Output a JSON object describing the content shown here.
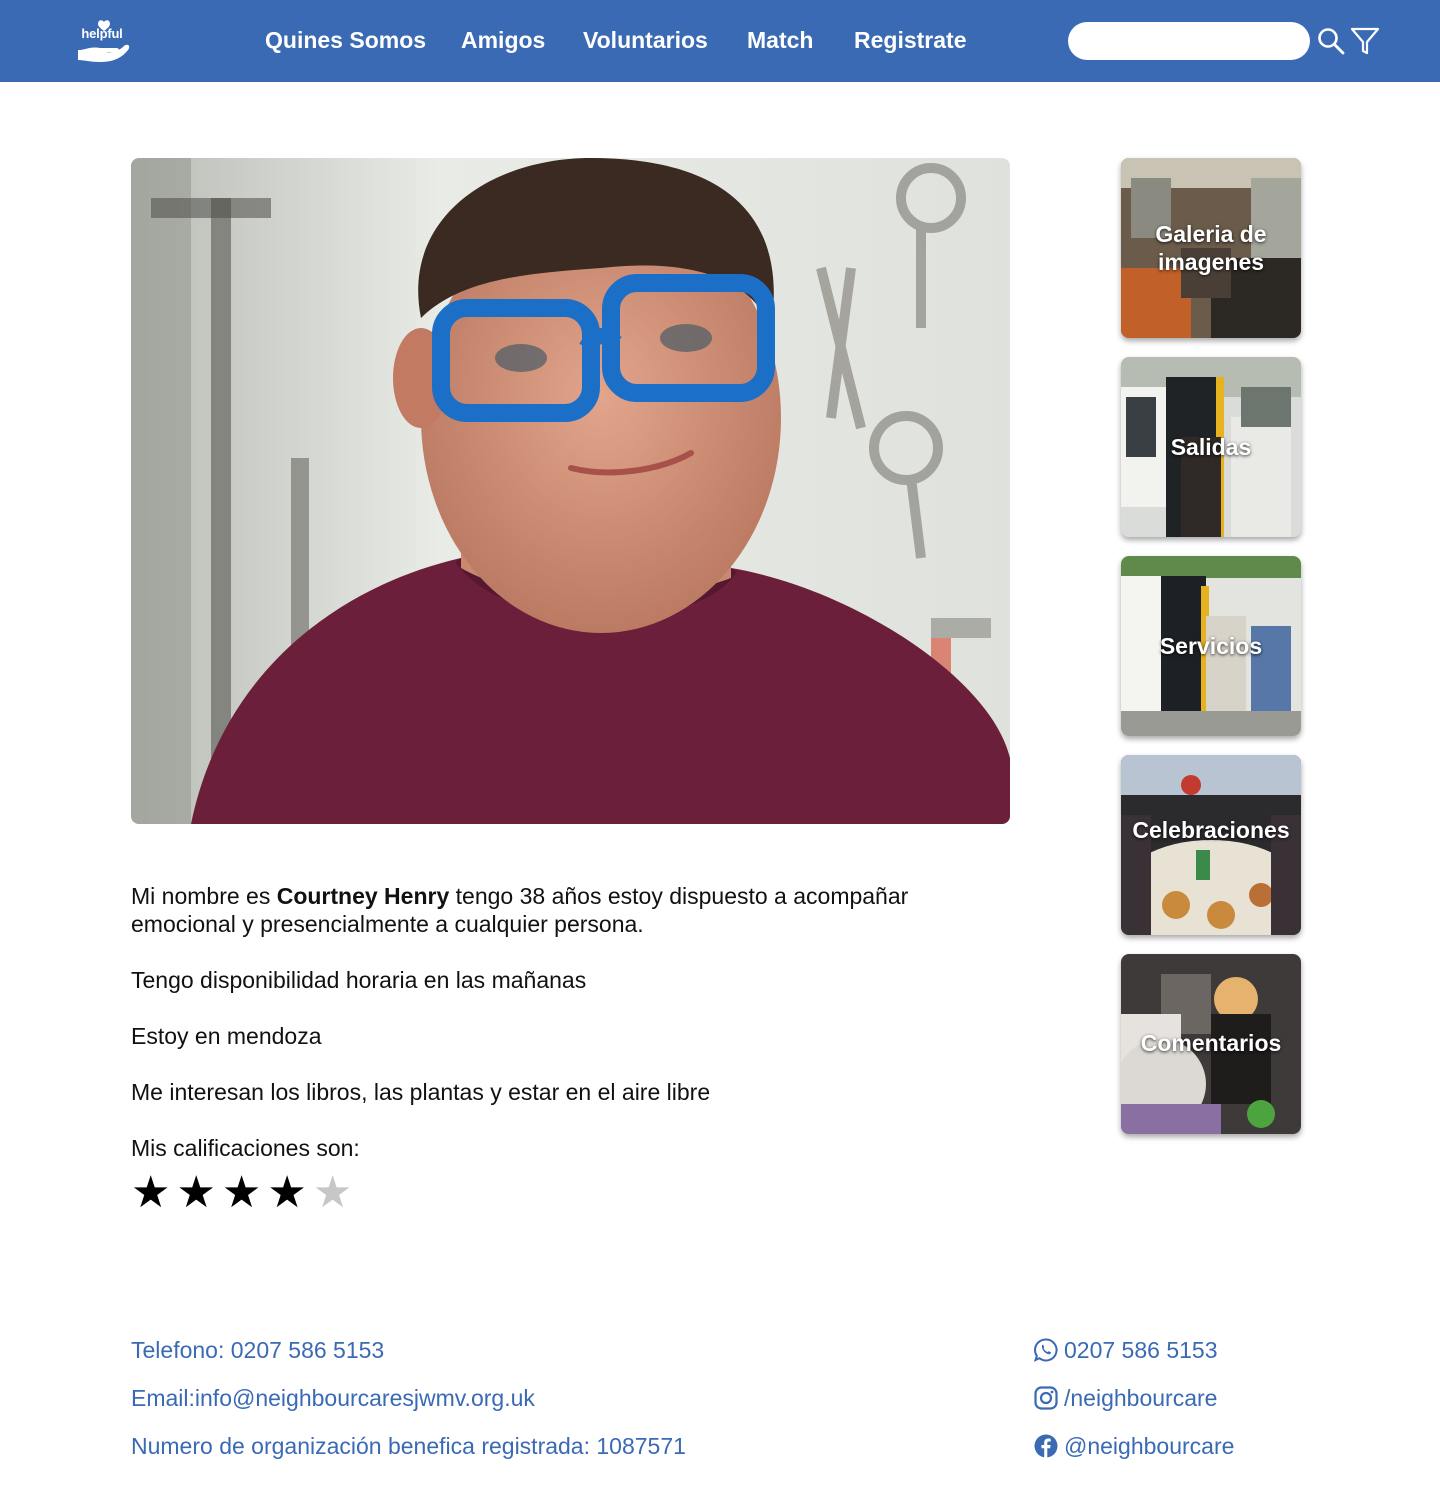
{
  "header": {
    "logo_text": "helpful",
    "nav": [
      "Quines Somos",
      "Amigos",
      "Voluntarios",
      "Match",
      "Registrate"
    ],
    "search": {
      "value": "",
      "placeholder": ""
    },
    "colors": {
      "primary": "#3a6ab4",
      "text_on_primary": "#ffffff"
    },
    "icons": [
      "search-icon",
      "filter-icon"
    ]
  },
  "profile": {
    "photo_alt": "Courtney Henry",
    "intro_before": "Mi nombre es ",
    "name": "Courtney Henry",
    "intro_after": " tengo 38 años estoy dispuesto a acompañar emocional y presencialmente a cualquier persona.",
    "availability": "Tengo disponibilidad horaria en las mañanas",
    "location": "Estoy en mendoza",
    "interests": "Me interesan los libros, las plantas y estar en el aire libre",
    "ratings_label": "Mis calificaciones son:",
    "rating": 4,
    "rating_max": 5
  },
  "sidebar": {
    "cards": [
      {
        "label_line1": "Galeria de",
        "label_line2": "imagenes"
      },
      {
        "label": "Salidas"
      },
      {
        "label": "Servicios"
      },
      {
        "label": "Celebraciones"
      },
      {
        "label": "Comentarios"
      }
    ]
  },
  "footer": {
    "phone": "Telefono: 0207 586 5153",
    "email": "Email:info@neighbourcaresjwmv.org.uk",
    "charity": "Numero de organización benefica registrada: 1087571",
    "whatsapp": "0207 586 5153",
    "instagram": "/neighbourcare",
    "facebook": "@neighbourcare",
    "icons": [
      "whatsapp-icon",
      "instagram-icon",
      "facebook-icon"
    ]
  }
}
